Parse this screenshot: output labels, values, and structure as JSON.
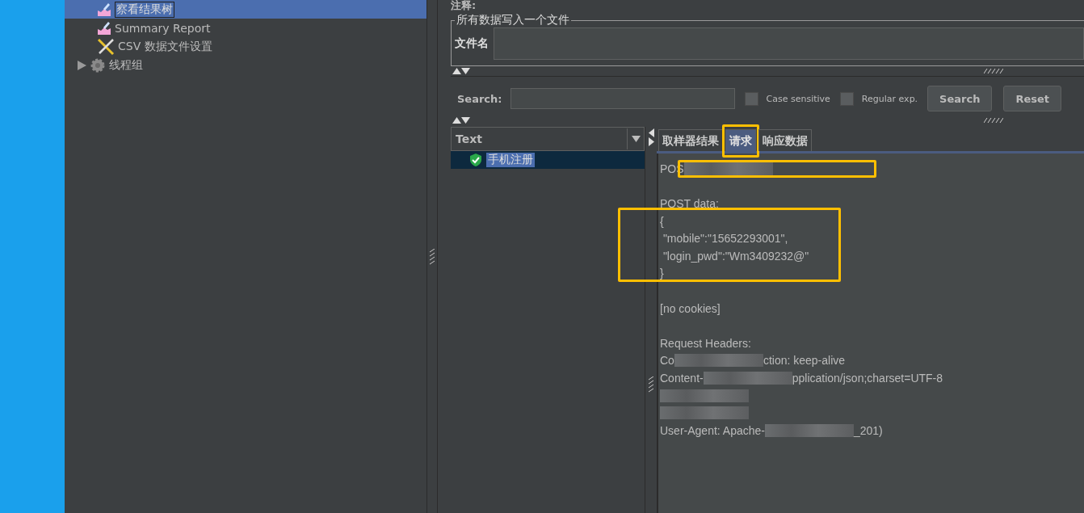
{
  "tree": {
    "items": [
      {
        "label": "察看结果树",
        "kind": "listener",
        "selected": true
      },
      {
        "label": "Summary Report",
        "kind": "listener",
        "selected": false
      },
      {
        "label": "CSV 数据文件设置",
        "kind": "config",
        "selected": false
      },
      {
        "label": "线程组",
        "kind": "group",
        "selected": false,
        "expanded": false
      }
    ]
  },
  "comment_label": "注释:",
  "file_group": {
    "title": "所有数据写入一个文件",
    "field_label": "文件名"
  },
  "search": {
    "label": "Search:",
    "case_sensitive": {
      "label": "Case sensitive",
      "checked": false
    },
    "regular_exp": {
      "label": "Regular exp.",
      "checked": false
    },
    "buttons": [
      "Search",
      "Reset"
    ]
  },
  "renderer": {
    "value": "Text"
  },
  "results": [
    {
      "label": "手机注册",
      "selected": true,
      "success": true
    }
  ],
  "tabs": [
    {
      "label": "取样器结果",
      "selected": false
    },
    {
      "label": "请求",
      "selected": true
    },
    {
      "label": "响应数据",
      "selected": false
    }
  ],
  "request_lines": [
    [
      {
        "kind": "text",
        "text": "POS"
      },
      {
        "kind": "mosaic"
      }
    ],
    [
      {
        "kind": "gap"
      },
      {
        "kind": "text",
        "text": "POST data:"
      }
    ],
    [
      {
        "kind": "text",
        "text": "{"
      }
    ],
    [
      {
        "kind": "text",
        "text": " \"mobile\":\"15652293001\","
      }
    ],
    [
      {
        "kind": "text",
        "text": " \"login_pwd\":\"Wm3409232@\""
      }
    ],
    [
      {
        "kind": "text",
        "text": "}"
      }
    ],
    [
      {
        "kind": "gap"
      },
      {
        "kind": "text",
        "text": "[no cookies]"
      }
    ],
    [
      {
        "kind": "gap"
      },
      {
        "kind": "text",
        "text": "Request Headers:"
      }
    ],
    [
      {
        "kind": "text",
        "text": "Co"
      },
      {
        "kind": "mosaic"
      },
      {
        "kind": "text",
        "text": "ction: keep-alive"
      }
    ],
    [
      {
        "kind": "text",
        "text": "Content-"
      },
      {
        "kind": "mosaic"
      },
      {
        "kind": "text",
        "text": "pplication/json;charset=UTF-8"
      }
    ],
    [
      {
        "kind": "mosaic"
      }
    ],
    [
      {
        "kind": "mosaic"
      }
    ],
    [
      {
        "kind": "text",
        "text": "User-Agent: Apache-"
      },
      {
        "kind": "mosaic"
      },
      {
        "kind": "text",
        "text": "_201)"
      }
    ]
  ]
}
